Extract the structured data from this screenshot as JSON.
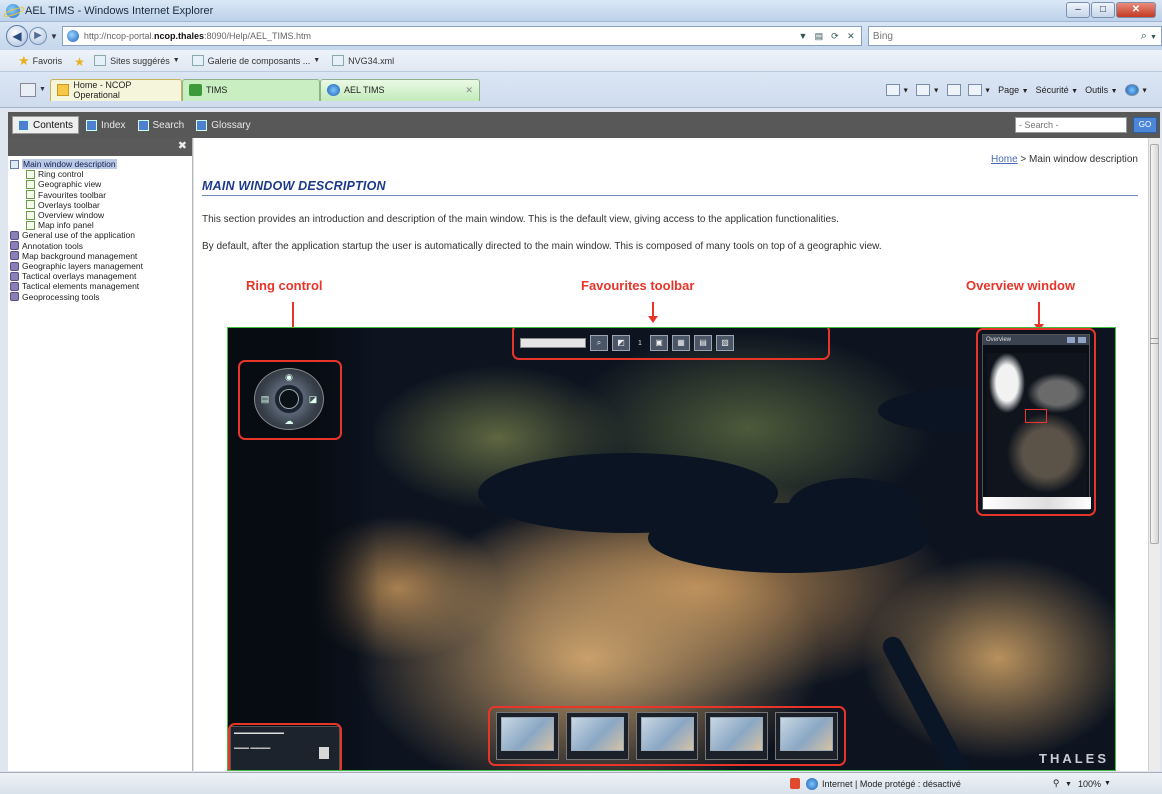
{
  "window": {
    "title": "AEL TIMS - Windows Internet Explorer",
    "controls": {
      "minimize": "–",
      "maximize": "□",
      "close": "✕"
    }
  },
  "address_bar": {
    "url_prefix": "http://ncop-portal.",
    "url_host": "ncop.thales",
    "url_suffix": ":8090/Help/AEL_TIMS.htm",
    "search_placeholder": "Bing"
  },
  "favorites_bar": {
    "favorites_label": "Favoris",
    "items": [
      {
        "label": "Sites suggérés",
        "icon": "ie-page-icon",
        "has_menu": true
      },
      {
        "label": "Galerie de composants ...",
        "icon": "ie-page-icon",
        "has_menu": true
      },
      {
        "label": "NVG34.xml",
        "icon": "xml-file-icon",
        "has_menu": false
      }
    ]
  },
  "tabs": [
    {
      "label": "Home - NCOP Operational"
    },
    {
      "label": "TIMS"
    },
    {
      "label": "AEL TIMS"
    }
  ],
  "command_bar": {
    "page": "Page",
    "security": "Sécurité",
    "tools": "Outils"
  },
  "help_toolbar": {
    "tabs": [
      "Contents",
      "Index",
      "Search",
      "Glossary"
    ],
    "search_placeholder": "- Search -",
    "go": "GO"
  },
  "toc": {
    "items": [
      {
        "label": "Main window description",
        "level": 0,
        "icon": "open-book-icon",
        "selected": true
      },
      {
        "label": "Ring control",
        "level": 1,
        "icon": "page-icon"
      },
      {
        "label": "Geographic view",
        "level": 1,
        "icon": "page-icon"
      },
      {
        "label": "Favourites toolbar",
        "level": 1,
        "icon": "page-icon"
      },
      {
        "label": "Overlays toolbar",
        "level": 1,
        "icon": "page-icon"
      },
      {
        "label": "Overview window",
        "level": 1,
        "icon": "page-icon"
      },
      {
        "label": "Map info panel",
        "level": 1,
        "icon": "page-icon"
      },
      {
        "label": "General use of the application",
        "level": 0,
        "icon": "closed-book-icon"
      },
      {
        "label": "Annotation tools",
        "level": 0,
        "icon": "closed-book-icon"
      },
      {
        "label": "Map background management",
        "level": 0,
        "icon": "closed-book-icon"
      },
      {
        "label": "Geographic layers management",
        "level": 0,
        "icon": "closed-book-icon"
      },
      {
        "label": "Tactical overlays management",
        "level": 0,
        "icon": "closed-book-icon"
      },
      {
        "label": "Tactical elements management",
        "level": 0,
        "icon": "closed-book-icon"
      },
      {
        "label": "Geoprocessing tools",
        "level": 0,
        "icon": "closed-book-icon"
      }
    ]
  },
  "content": {
    "breadcrumb_home": "Home",
    "breadcrumb_current": " > Main window description",
    "title": "MAIN WINDOW DESCRIPTION",
    "paragraph1": "This section provides an introduction and description of the main window. This is the default view, giving access to the application functionalities.",
    "paragraph2": "By default, after the application startup the user is automatically directed to the main window. This is composed of many tools on top of a geographic view.",
    "callouts": {
      "ring": "Ring control",
      "favourites": "Favourites toolbar",
      "overview": "Overview window"
    },
    "map": {
      "overview_title": "Overview",
      "brand": "THALES"
    }
  },
  "status_bar": {
    "zone": "Internet | Mode protégé : désactivé",
    "zoom": "100%"
  },
  "colors": {
    "callout_red": "#e8352a",
    "title_blue": "#1c3a8c",
    "map_border_green": "#3fbf3f",
    "help_toolbar_gray": "#585858"
  }
}
